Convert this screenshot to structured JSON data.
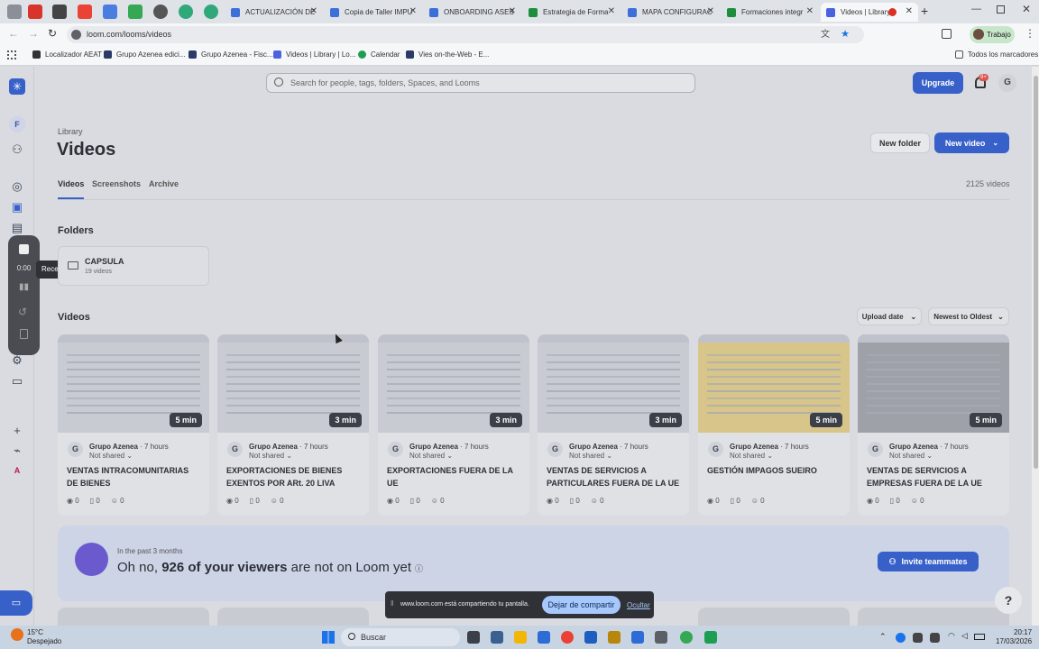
{
  "browser": {
    "tabs": [
      {
        "label": "ACTUALIZACIÓN DE",
        "color": "#3d6fd8"
      },
      {
        "label": "Copia de Taller IMPU",
        "color": "#3d6fd8"
      },
      {
        "label": "ONBOARDING ASES",
        "color": "#3d6fd8"
      },
      {
        "label": "Estrategia de Forma",
        "color": "#1e8e3e"
      },
      {
        "label": "MAPA CONFIGURAC",
        "color": "#3d6fd8"
      },
      {
        "label": "Formaciones integr",
        "color": "#1e8e3e"
      },
      {
        "label": "Videos | Library",
        "color": "#4b62e0"
      }
    ],
    "new_tab": "+",
    "url": "loom.com/looms/videos",
    "profile": "Trabajo",
    "bookmarks": [
      "Localizador AEAT",
      "Grupo Azenea edici...",
      "Grupo Azenea - Fisc...",
      "Videos | Library | Lo...",
      "Calendar",
      "Vies on-the-Web - E..."
    ],
    "all_bookmarks": "Todos los marcadores"
  },
  "app": {
    "search_placeholder": "Search for people, tags, folders, Spaces, and Looms",
    "upgrade": "Upgrade",
    "notif_badge": "9+",
    "user_initial": "G",
    "workspace_initial": "F",
    "breadcrumb": "Library",
    "title": "Videos",
    "new_folder": "New folder",
    "new_video": "New video",
    "tabs": [
      "Videos",
      "Screenshots",
      "Archive"
    ],
    "video_count": "2125 videos",
    "folders_heading": "Folders",
    "folder": {
      "name": "CAPSULA",
      "count": "19 videos"
    },
    "videos_heading": "Videos",
    "filter_date": "Upload date",
    "filter_sort": "Newest to Oldest",
    "recorder": {
      "time": "0:00",
      "tooltip": "Recent"
    },
    "rail_bottom_initial": "A",
    "videos": [
      {
        "duration": "5 min",
        "author": "Grupo Azenea",
        "ago": "· 7 hours",
        "share": "Not shared",
        "title": "VENTAS INTRACOMUNITARIAS DE BIENES",
        "views": "0",
        "comments": "0",
        "reactions": "0"
      },
      {
        "duration": "3 min",
        "author": "Grupo Azenea",
        "ago": "· 7 hours",
        "share": "Not shared",
        "title": "EXPORTACIONES DE BIENES EXENTOS POR ARt. 20 LIVA",
        "views": "0",
        "comments": "0",
        "reactions": "0"
      },
      {
        "duration": "3 min",
        "author": "Grupo Azenea",
        "ago": "· 7 hours",
        "share": "Not shared",
        "title": "EXPORTACIONES FUERA DE LA UE",
        "views": "0",
        "comments": "0",
        "reactions": "0"
      },
      {
        "duration": "3 min",
        "author": "Grupo Azenea",
        "ago": "· 7 hours",
        "share": "Not shared",
        "title": "VENTAS DE SERVICIOS A PARTICULARES FUERA DE LA UE",
        "views": "0",
        "comments": "0",
        "reactions": "0"
      },
      {
        "duration": "5 min",
        "author": "Grupo Azenea",
        "ago": "· 7 hours",
        "share": "Not shared",
        "title": "GESTIÓN IMPAGOS SUEIRO",
        "views": "0",
        "comments": "0",
        "reactions": "0"
      },
      {
        "duration": "5 min",
        "author": "Grupo Azenea",
        "ago": "· 7 hours",
        "share": "Not shared",
        "title": "VENTAS DE SERVICIOS A EMPRESAS FUERA DE LA UE",
        "views": "0",
        "comments": "0",
        "reactions": "0"
      }
    ],
    "banner": {
      "small": "In the past 3 months",
      "pre": "Oh no, ",
      "highlight": "926 of your viewers",
      "post": " are not on Loom yet",
      "invite": "Invite teammates"
    },
    "help": "?",
    "share_bar": {
      "text": "www.loom.com está compartiendo tu pantalla.",
      "stop": "Dejar de compartir",
      "hide": "Ocultar"
    }
  },
  "taskbar": {
    "weather_temp": "15°C",
    "weather_desc": "Despejado",
    "search": "Buscar",
    "time": "20:17",
    "date": "17/03/2026"
  }
}
